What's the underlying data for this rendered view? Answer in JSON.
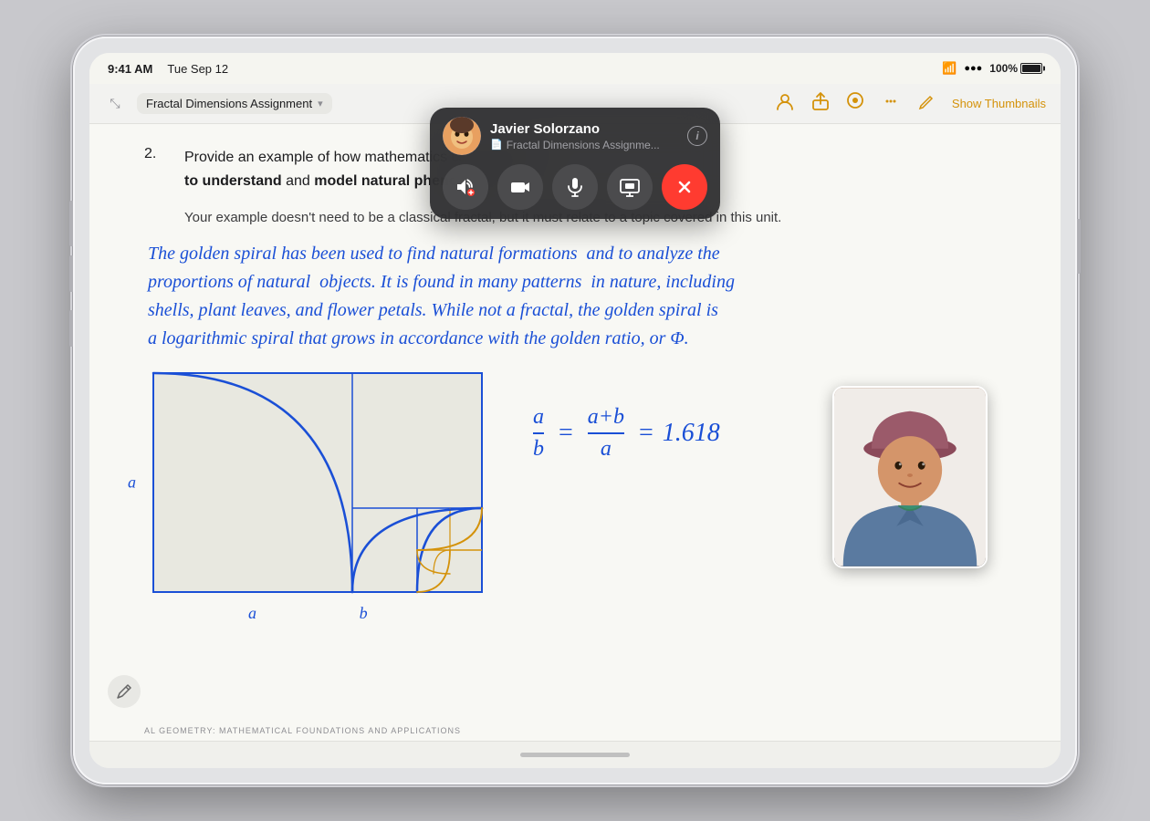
{
  "device": {
    "status_bar": {
      "time": "9:41 AM",
      "date": "Tue Sep 12",
      "battery_percent": "100%",
      "wifi": true,
      "signal": true
    }
  },
  "toolbar": {
    "collapse_icon": "⤡",
    "document_name": "Fractal Dimensions Assignment",
    "dropdown_icon": "▾",
    "icons": {
      "person_icon": "👤",
      "share_icon": "⬆",
      "highlight_icon": "✏",
      "comment_icon": "⋯",
      "edit_icon": "✎"
    },
    "show_thumbnails": "Show Thumbnails"
  },
  "content": {
    "question_number": "2.",
    "question_bold": "Provide an example of how mathematics can be used to understand",
    "question_rest": "and",
    "question_bold2": "model natural phenomena",
    "question_end": ".",
    "question_sub": "Your example doesn't need to be a classical fractal, but it must relate to a topic covered in this unit.",
    "handwritten": "The golden spiral has been used to find natural formations and to analyze the proportions of natural objects. It is found in many patterns in nature, including shells, plant leaves, and flower petals. While not a fractal, the golden spiral is a logarithmic spiral that grows in accordance with the golden ratio, or Φ.",
    "math_equation": "a/b = (a+b)/a = 1.618",
    "label_a_side": "a",
    "label_a_bottom": "a",
    "label_b_bottom": "b",
    "footer_text": "AL GEOMETRY: MATHEMATICAL FOUNDATIONS AND APPLICATIONS"
  },
  "facetime": {
    "user_name": "Javier Solorzano",
    "doc_preview": "Fractal Dimensions Assignme...",
    "doc_icon": "📄",
    "info_label": "i",
    "controls": {
      "speaker": "🔊",
      "camera": "📷",
      "mute": "🎤",
      "screen_share": "⬛",
      "end_call": "✕"
    }
  }
}
